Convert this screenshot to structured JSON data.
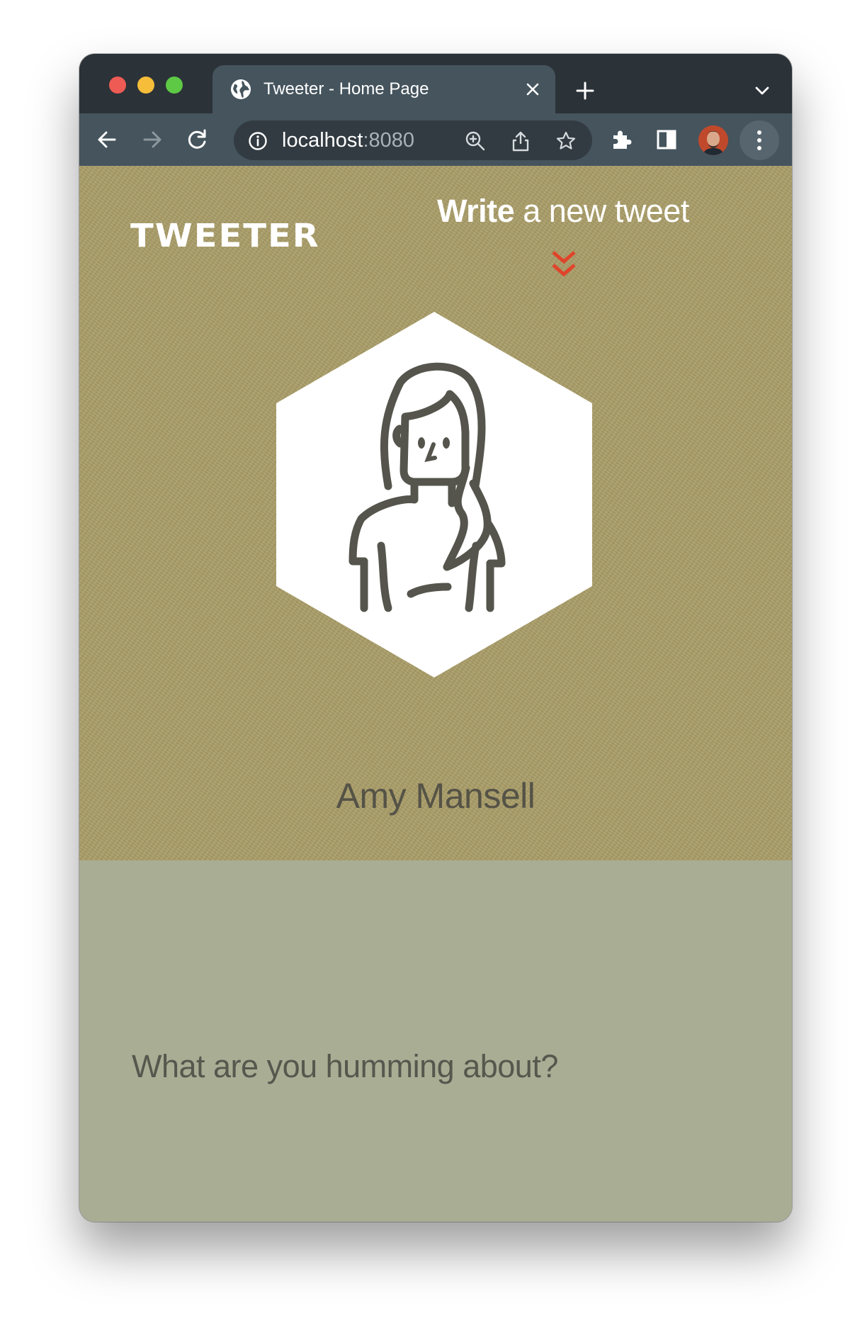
{
  "browser": {
    "tab_title": "Tweeter - Home Page",
    "url_host": "localhost",
    "url_port": ":8080"
  },
  "page": {
    "logo": "TWEETER",
    "compose_bold": "Write",
    "compose_rest": " a new tweet",
    "user_name": "Amy Mansell",
    "tweet_placeholder": "What are you humming about?"
  },
  "colors": {
    "header_bg": "#a99d68",
    "body_bg": "#a9ad94",
    "accent_red": "#e0442a",
    "avatar_stroke": "#55554d"
  },
  "icons": {
    "tab": "globe-icon",
    "nav": [
      "back-arrow-icon",
      "forward-arrow-icon",
      "reload-icon"
    ],
    "omnibox": [
      "info-icon",
      "zoom-icon",
      "share-icon",
      "star-icon"
    ],
    "toolbar": [
      "extensions-icon",
      "side-panel-icon",
      "profile-avatar",
      "more-vert-icon"
    ],
    "page": [
      "double-chevron-down-icon",
      "user-avatar-icon"
    ]
  }
}
